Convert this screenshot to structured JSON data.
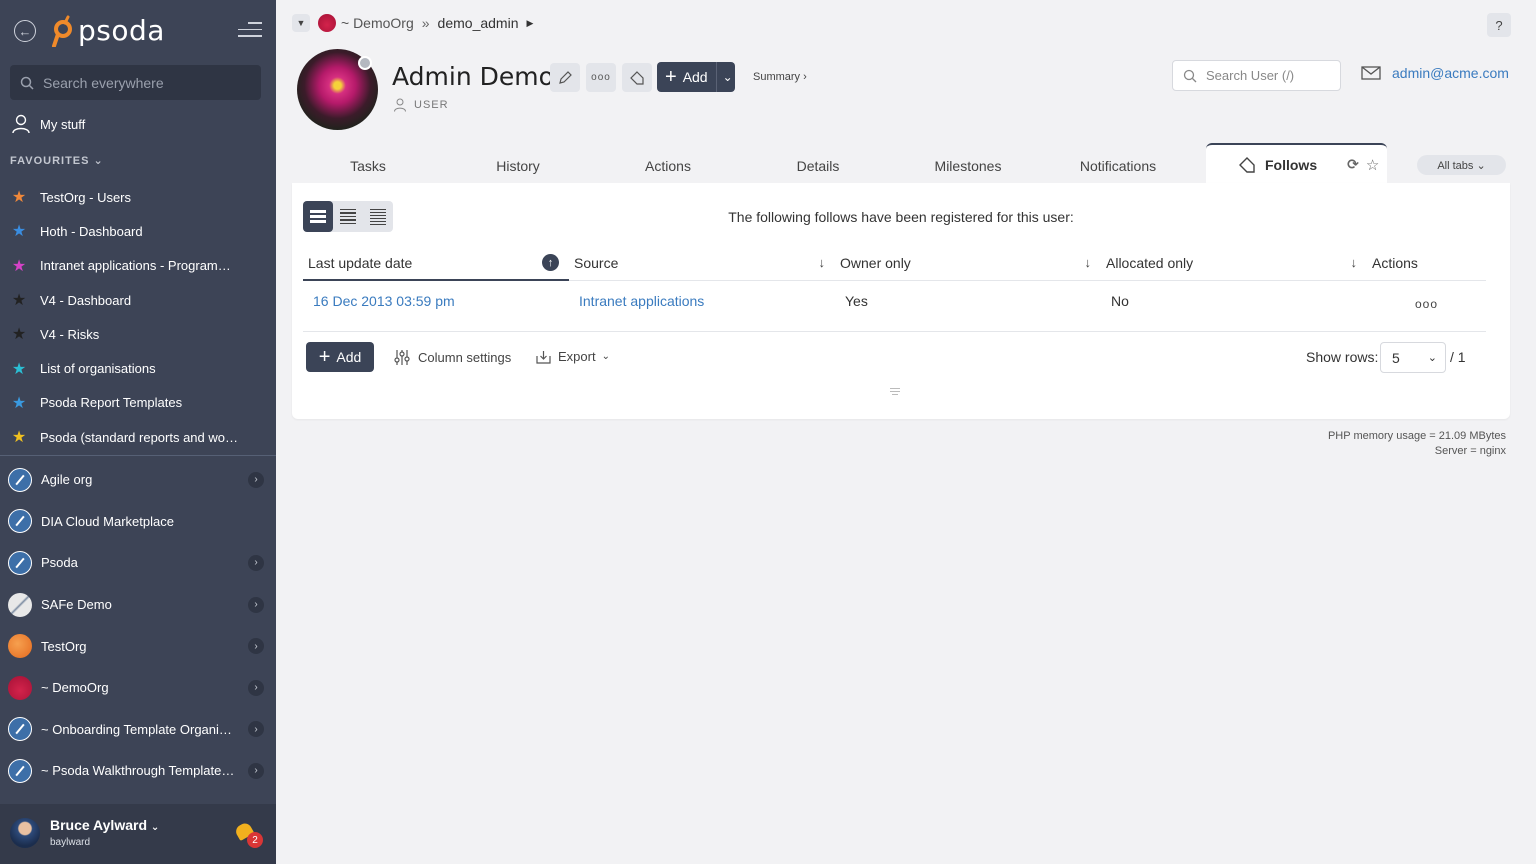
{
  "app": {
    "logo_text": "psoda"
  },
  "sidebar": {
    "search_placeholder": "Search everywhere",
    "my_stuff": "My stuff",
    "favourites_heading": "FAVOURITES",
    "favourites": [
      {
        "label": "TestOrg - Users",
        "star_color": "#f0883a"
      },
      {
        "label": "Hoth - Dashboard",
        "star_color": "#3a8de0"
      },
      {
        "label": "Intranet applications - Programme...",
        "star_color": "#d542c8"
      },
      {
        "label": "V4 - Dashboard",
        "star_color": "#222222"
      },
      {
        "label": "V4 - Risks",
        "star_color": "#222222"
      },
      {
        "label": "List of organisations",
        "star_color": "#2bbfd4"
      },
      {
        "label": "Psoda Report Templates",
        "star_color": "#3a9ae0"
      },
      {
        "label": "Psoda (standard reports and work...",
        "star_color": "#f0c020"
      }
    ],
    "orgs": [
      {
        "label": "Agile org",
        "icon": "pen",
        "expandable": true
      },
      {
        "label": "DIA Cloud Marketplace",
        "icon": "pen",
        "expandable": false
      },
      {
        "label": "Psoda",
        "icon": "pen",
        "expandable": true
      },
      {
        "label": "SAFe Demo",
        "icon": "safe",
        "expandable": true
      },
      {
        "label": "TestOrg",
        "icon": "testorg",
        "expandable": true
      },
      {
        "label": "~ DemoOrg",
        "icon": "demo",
        "expandable": true
      },
      {
        "label": "~ Onboarding Template Organisa...",
        "icon": "pen",
        "expandable": true
      },
      {
        "label": "~ Psoda Walkthrough Template P...",
        "icon": "pen",
        "expandable": true
      }
    ],
    "user": {
      "name": "Bruce Aylward",
      "login": "baylward",
      "notifications": "2"
    }
  },
  "breadcrumb": {
    "org": "~ DemoOrg",
    "separator": "»",
    "user": "demo_admin"
  },
  "help": "?",
  "profile": {
    "name": "Admin Demo",
    "type": "USER",
    "add_label": "Add",
    "summary_label": "Summary ›",
    "search_placeholder": "Search User (/)",
    "email": "admin@acme.com"
  },
  "tabs": [
    "Tasks",
    "History",
    "Actions",
    "Details",
    "Milestones",
    "Notifications"
  ],
  "active_tab": "Follows",
  "all_tabs": "All tabs ⌄",
  "panel": {
    "intro": "The following follows have been registered for this user:",
    "columns": [
      "Last update date",
      "Source",
      "Owner only",
      "Allocated only",
      "Actions"
    ],
    "rows": [
      {
        "date": "16 Dec 2013 03:59 pm",
        "source": "Intranet applications",
        "owner_only": "Yes",
        "allocated_only": "No",
        "actions": "ooo"
      }
    ],
    "add_label": "Add",
    "column_settings": "Column settings",
    "export": "Export",
    "show_rows_label": "Show rows:",
    "rows_value": "5",
    "pages": "/ 1"
  },
  "footer": {
    "memory": "PHP memory usage = 21.09 MBytes",
    "server": "Server = nginx"
  }
}
